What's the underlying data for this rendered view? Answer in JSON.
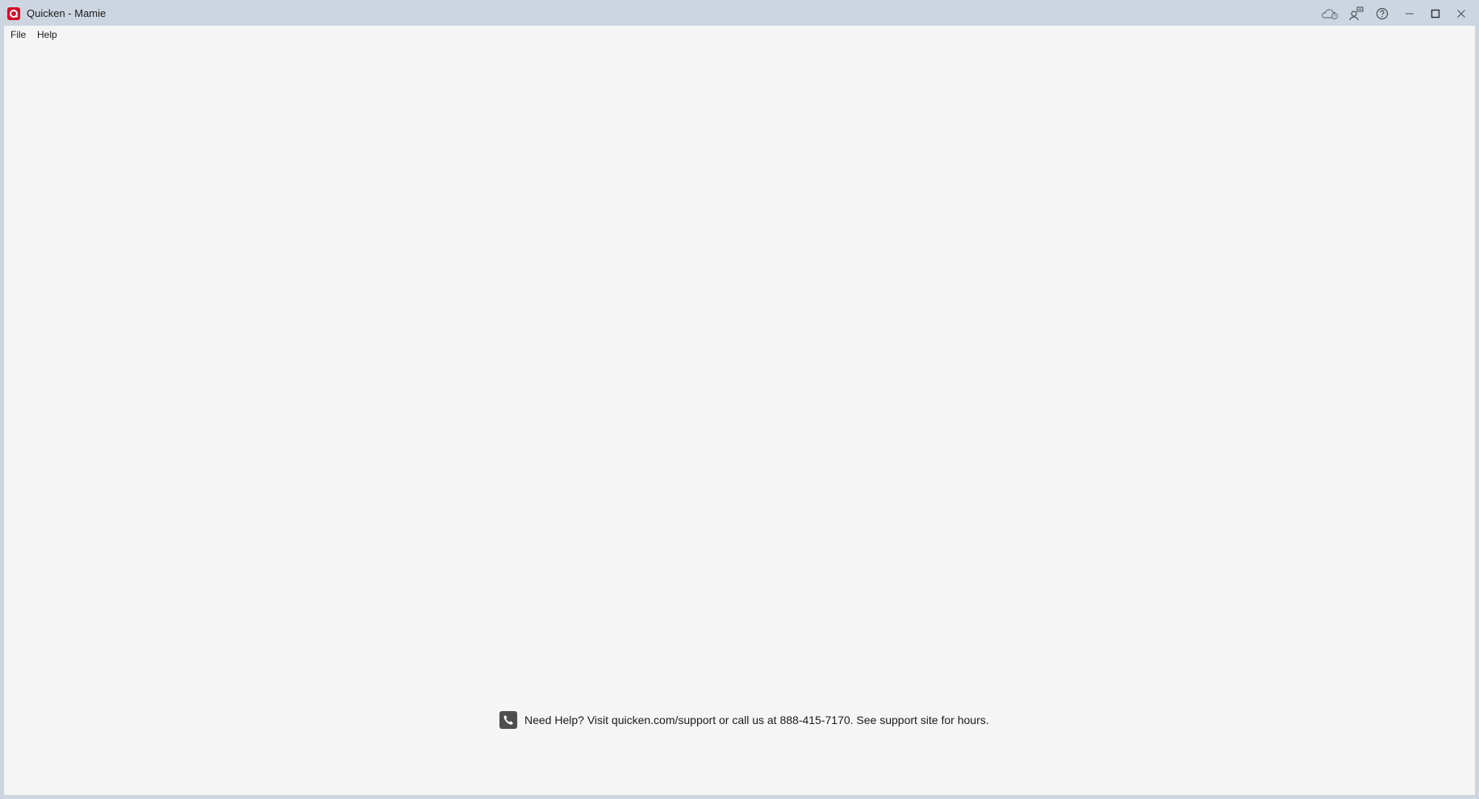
{
  "window": {
    "title": "Quicken - Mamie"
  },
  "titlebar_icons": [
    "cloud-sync-icon",
    "account-feedback-icon",
    "help-icon",
    "minimize-icon",
    "maximize-icon",
    "close-icon"
  ],
  "menu": {
    "file_label": "File",
    "help_label": "Help"
  },
  "support": {
    "message": "Need Help? Visit quicken.com/support or call us at 888-415-7170. See support site for hours."
  },
  "colors": {
    "brand_red": "#d2102c",
    "titlebar": "#cdd6e0",
    "client_background": "#f5f5f5"
  }
}
